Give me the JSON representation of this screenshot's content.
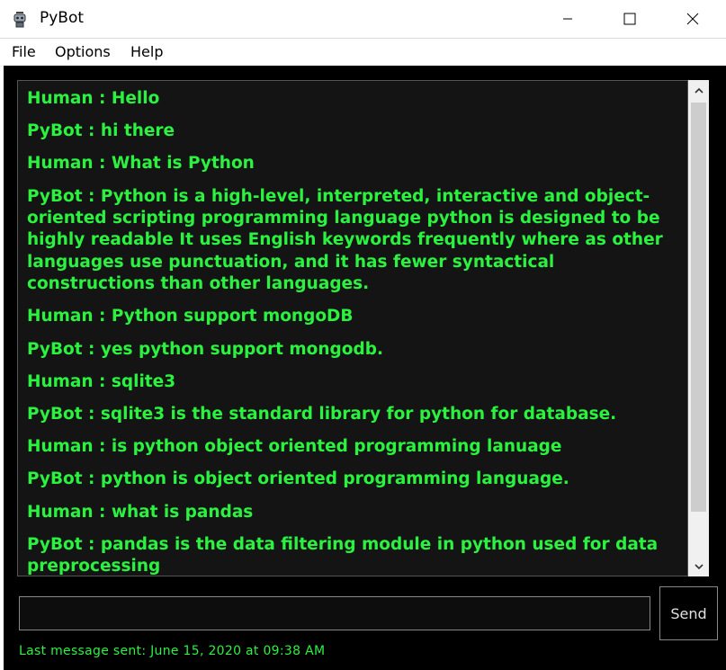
{
  "window": {
    "title": "PyBot"
  },
  "menu": {
    "items": [
      "File",
      "Options",
      "Help"
    ]
  },
  "chat": {
    "messages": [
      "Human : Hello",
      "PyBot : hi there",
      "Human : What is Python",
      "PyBot : Python is a high-level, interpreted, interactive and object-oriented scripting programming language python is designed to be highly readable It uses English keywords frequently where as other languages use punctuation, and it has fewer syntactical constructions than other languages.",
      "Human : Python support mongoDB",
      "PyBot : yes python support mongodb.",
      "Human : sqlite3",
      "PyBot : sqlite3 is the standard library for python for database.",
      "Human : is python object oriented programming lanuage",
      "PyBot : python is object oriented programming language.",
      "Human : what is pandas",
      "PyBot : pandas is the data filtering module in python used for data preprocessing"
    ]
  },
  "input": {
    "value": ""
  },
  "send_label": "Send",
  "status": "Last message sent: June 15, 2020 at 09:38 AM",
  "colors": {
    "text": "#2af23f",
    "background": "#000000",
    "chat_background": "#141414"
  },
  "icons": {
    "app": "robot-icon",
    "minimize": "minimize-icon",
    "maximize": "maximize-icon",
    "close": "close-icon"
  }
}
